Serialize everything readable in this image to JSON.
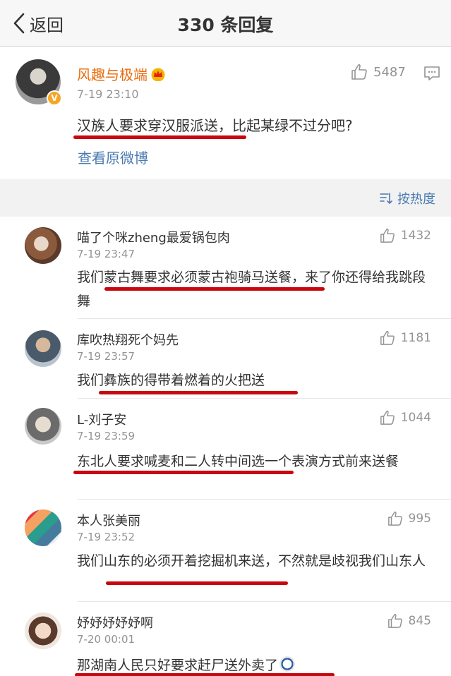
{
  "header": {
    "back_label": "返回",
    "title": "330 条回复"
  },
  "main_post": {
    "author": "风趣与极端",
    "time": "7-19 23:10",
    "likes": "5487",
    "text": "汉族人要求穿汉服派送，比起某绿不过分吧?",
    "view_original": "查看原微博"
  },
  "sort": {
    "label": "按热度"
  },
  "comments": [
    {
      "author": "喵了个咪zheng最爱锅包肉",
      "time": "7-19 23:47",
      "likes": "1432",
      "text": "我们蒙古舞要求必须蒙古袍骑马送餐，来了你还得给我跳段舞"
    },
    {
      "author": "库吹热翔死个妈先",
      "time": "7-19 23:57",
      "likes": "1181",
      "text": "我们彝族的得带着燃着的火把送"
    },
    {
      "author": "L-刘子安",
      "time": "7-19 23:59",
      "likes": "1044",
      "text": "东北人要求喊麦和二人转中间选一个表演方式前来送餐"
    },
    {
      "author": "本人张美丽",
      "time": "7-19 23:52",
      "likes": "995",
      "text": "我们山东的必须开着挖掘机来送，不然就是歧视我们山东人"
    },
    {
      "author": "妤妤妤妤妤啊",
      "time": "7-20 00:01",
      "likes": "845",
      "text": "那湖南人民只好要求赶尸送外卖了"
    }
  ],
  "colors": {
    "highlight_underline": "#c8060d",
    "author_vip": "#e86b0c",
    "link": "#4a7ab0"
  }
}
